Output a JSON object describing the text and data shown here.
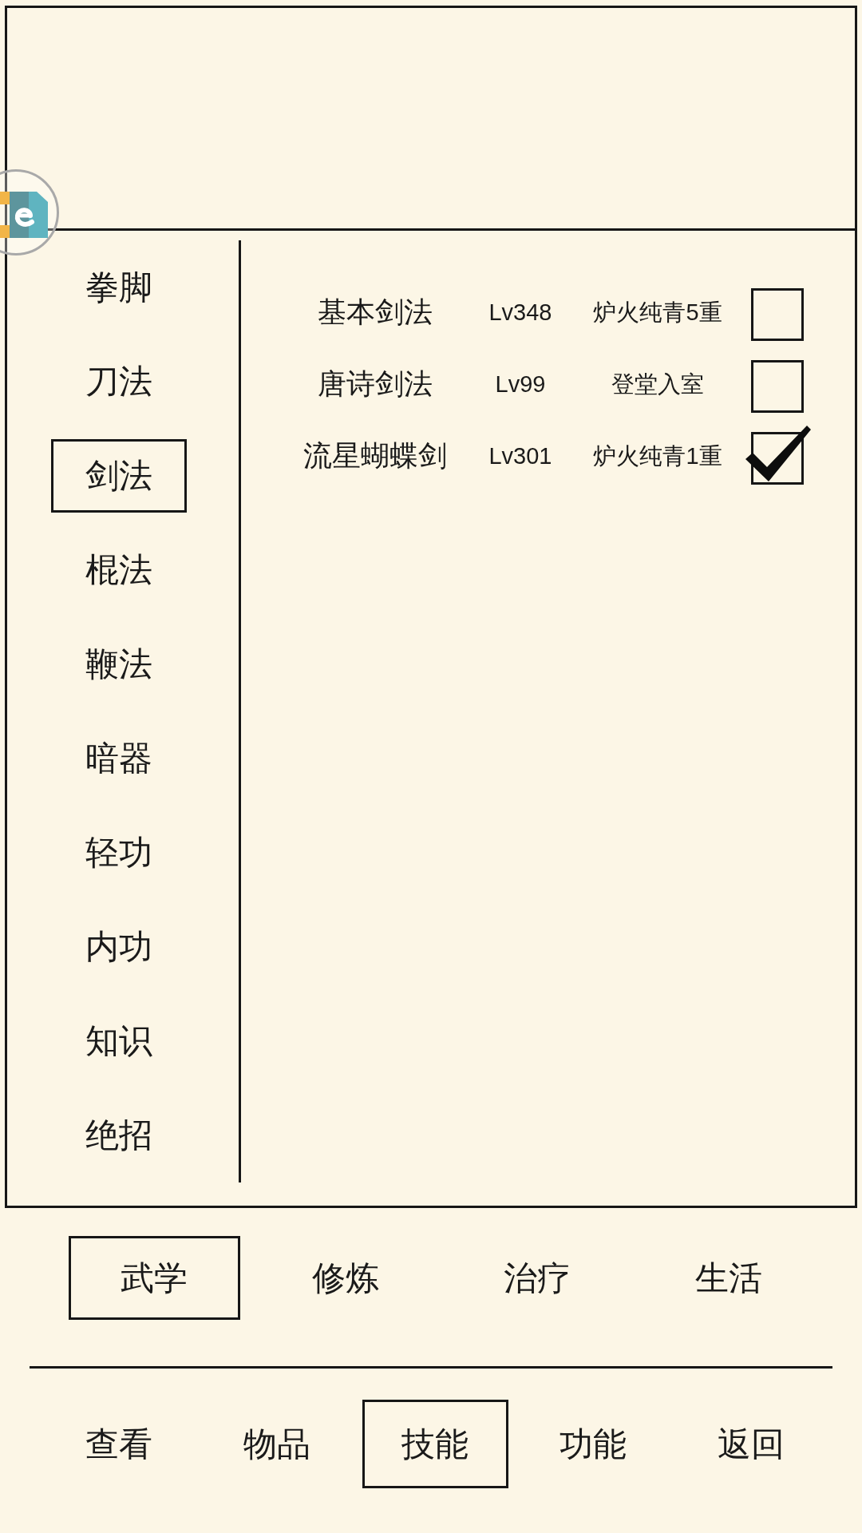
{
  "side_menu": [
    {
      "label": "拳脚",
      "selected": false
    },
    {
      "label": "刀法",
      "selected": false
    },
    {
      "label": "剑法",
      "selected": true
    },
    {
      "label": "棍法",
      "selected": false
    },
    {
      "label": "鞭法",
      "selected": false
    },
    {
      "label": "暗器",
      "selected": false
    },
    {
      "label": "轻功",
      "selected": false
    },
    {
      "label": "内功",
      "selected": false
    },
    {
      "label": "知识",
      "selected": false
    },
    {
      "label": "绝招",
      "selected": false
    }
  ],
  "skills": [
    {
      "name": "基本剑法",
      "grade": "Lv348",
      "stage": "炉火纯青5重",
      "checked": false
    },
    {
      "name": "唐诗剑法",
      "grade": "Lv99",
      "stage": "登堂入室",
      "checked": false
    },
    {
      "name": "流星蝴蝶剑",
      "grade": "Lv301",
      "stage": "炉火纯青1重",
      "checked": true
    }
  ],
  "skill_tabs": [
    {
      "label": "武学",
      "selected": true
    },
    {
      "label": "修炼",
      "selected": false
    },
    {
      "label": "治疗",
      "selected": false
    },
    {
      "label": "生活",
      "selected": false
    }
  ],
  "bottom_nav": [
    {
      "label": "查看",
      "selected": false
    },
    {
      "label": "物品",
      "selected": false
    },
    {
      "label": "技能",
      "selected": true
    },
    {
      "label": "功能",
      "selected": false
    },
    {
      "label": "返回",
      "selected": false
    }
  ]
}
